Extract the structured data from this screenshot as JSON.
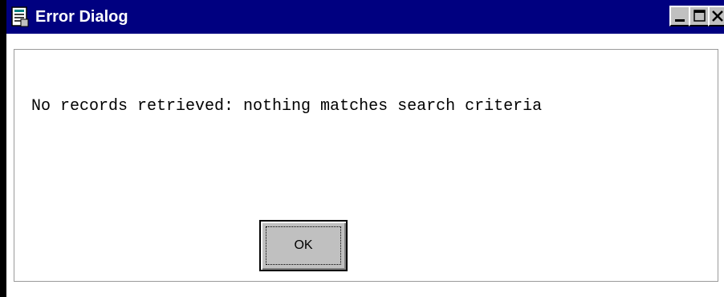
{
  "window": {
    "title": "Error Dialog",
    "titlebar_color": "#000080",
    "icons": {
      "app": "document-icon",
      "minimize": "minimize-icon",
      "maximize": "maximize-icon",
      "close": "close-icon"
    }
  },
  "dialog": {
    "message": "No records retrieved: nothing matches search criteria",
    "ok_label": "OK"
  }
}
